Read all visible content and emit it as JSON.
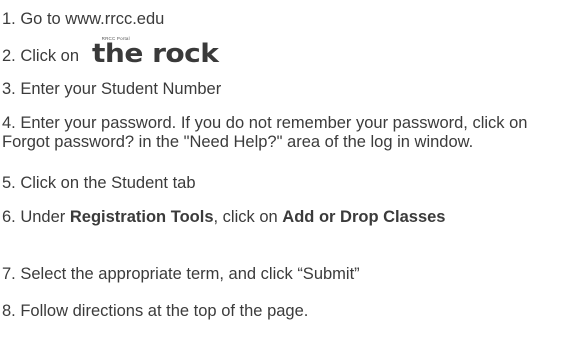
{
  "steps": [
    {
      "text": "1. Go to www.rrcc.edu"
    },
    {
      "text": "2. Click on",
      "logo_small": "RRCC Portal",
      "logo_main": "the rock"
    },
    {
      "text": "3. Enter your Student Number"
    },
    {
      "text": "4. Enter your password. If you do not remember your password, click on Forgot password? in the \"Need Help?\" area of the log in window."
    },
    {
      "text": "5. Click on the Student tab"
    },
    {
      "prefix": "6. Under ",
      "bold1": "Registration Tools",
      "mid": ", click on ",
      "bold2": "Add or Drop Classes"
    },
    {
      "text": "7. Select the appropriate term, and click “Submit”"
    },
    {
      "text": "8. Follow directions at the top of the page."
    }
  ]
}
